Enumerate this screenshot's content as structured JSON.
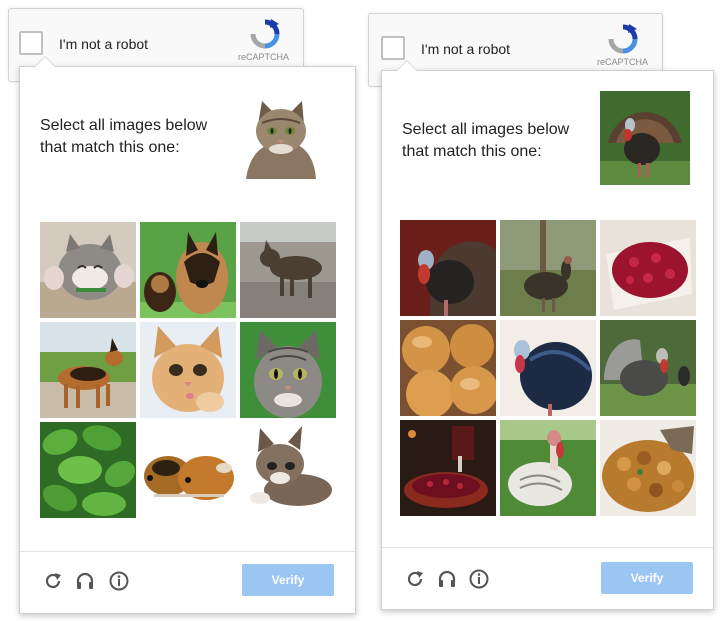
{
  "captchas": [
    {
      "anchor": {
        "label": "I'm not a robot",
        "brand": "reCAPTCHA"
      },
      "challenge": {
        "line1": "Select all images below",
        "line2": "that match this one:",
        "target": "cat",
        "tiles": [
          "kitten",
          "german-shepherd-puppies",
          "wolf-dog",
          "german-shepherd",
          "ginger-kitten",
          "tabby-kitten",
          "green-leaves",
          "guinea-pigs",
          "kitten-lying"
        ],
        "verify_label": "Verify",
        "icons": [
          "reload-icon",
          "audio-icon",
          "info-icon"
        ]
      }
    },
    {
      "anchor": {
        "label": "I'm not a robot",
        "brand": "reCAPTCHA"
      },
      "challenge": {
        "line1": "Select all images below",
        "line2": "that match this one:",
        "target": "turkey",
        "tiles": [
          "turkey",
          "wild-turkey",
          "cranberry-sauce",
          "bread-rolls",
          "turkey-black",
          "turkey-grey",
          "cranberry-dish",
          "white-turkey",
          "stuffing"
        ],
        "verify_label": "Verify",
        "icons": [
          "reload-icon",
          "audio-icon",
          "info-icon"
        ]
      }
    }
  ],
  "colors": {
    "verify_button": "#9bc6f4",
    "recaptcha_blue": "#4a90e2",
    "recaptcha_grey": "#a6a6a6"
  }
}
